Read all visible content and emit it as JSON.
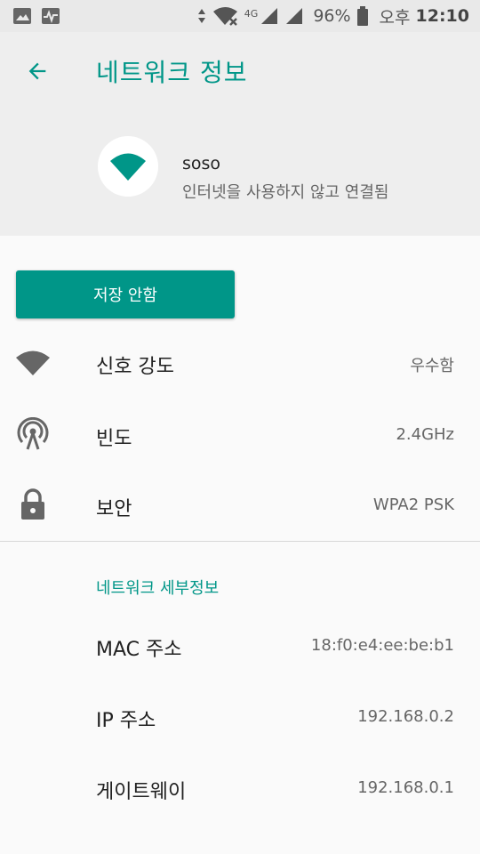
{
  "status_bar": {
    "battery": "96%",
    "ampm": "오후",
    "time": "12:10",
    "net_type": "4G"
  },
  "header": {
    "title": "네트워크 정보",
    "ssid": "soso",
    "status": "인터넷을 사용하지 않고 연결됨"
  },
  "forget_button": "저장 안함",
  "rows": [
    {
      "label": "신호 강도",
      "value": "우수함",
      "icon": "wifi-signal-icon"
    },
    {
      "label": "빈도",
      "value": "2.4GHz",
      "icon": "antenna-icon"
    },
    {
      "label": "보안",
      "value": "WPA2 PSK",
      "icon": "lock-icon"
    }
  ],
  "details": {
    "section_title": "네트워크 세부정보",
    "rows": [
      {
        "label": "MAC 주소",
        "value": "18:f0:e4:ee:be:b1"
      },
      {
        "label": "IP 주소",
        "value": "192.168.0.2"
      },
      {
        "label": "게이트웨이",
        "value": "192.168.0.1"
      }
    ]
  },
  "colors": {
    "accent": "#009688",
    "header_bg": "#eeeeee",
    "background": "#fafafa"
  }
}
